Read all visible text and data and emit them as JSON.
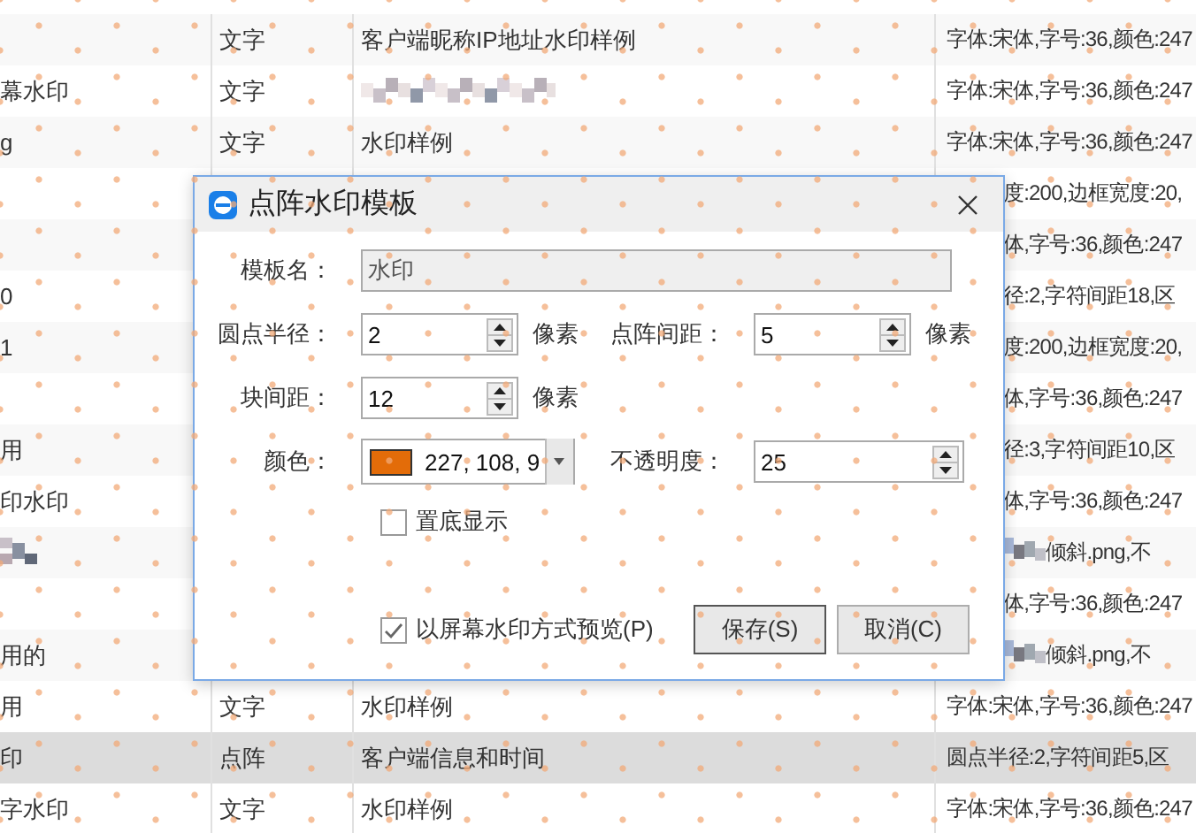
{
  "table": {
    "rows": [
      {
        "col1": "",
        "type": "文字",
        "content": "客户端昵称IP地址水印样例",
        "params": "字体:宋体,字号:36,颜色:247",
        "selected": false
      },
      {
        "col1": "幕水印",
        "type": "文字",
        "content_pixelated": true,
        "params": "字体:宋体,字号:36,颜色:247",
        "selected": false
      },
      {
        "col1": "g",
        "type": "文字",
        "content": "水印样例",
        "params": "字体:宋体,字号:36,颜色:247",
        "selected": false
      },
      {
        "col1": "",
        "covered": true,
        "params": "度:200,边框宽度:20,",
        "selected": false
      },
      {
        "col1": "",
        "covered": true,
        "params": "体,字号:36,颜色:247",
        "selected": false
      },
      {
        "col1": "0",
        "covered": true,
        "params": "径:2,字符间距18,区",
        "selected": false
      },
      {
        "col1": "1",
        "covered": true,
        "params": "度:200,边框宽度:20,",
        "selected": false
      },
      {
        "col1": "",
        "covered": true,
        "params": "体,字号:36,颜色:247",
        "selected": false
      },
      {
        "col1": "用",
        "covered": true,
        "params": "径:3,字符间距10,区",
        "selected": false
      },
      {
        "col1": "印水印",
        "covered": true,
        "params": "体,字号:36,颜色:247",
        "selected": false
      },
      {
        "col1_pixelated": true,
        "covered": true,
        "params_pixelated": true,
        "params": "倾斜.png,不",
        "selected": false
      },
      {
        "col1": "",
        "covered": true,
        "params": "体,字号:36,颜色:247",
        "selected": false
      },
      {
        "col1": "用的",
        "covered": true,
        "params_pixelated": true,
        "params": "倾斜.png,不",
        "selected": false
      },
      {
        "col1": "用",
        "type": "文字",
        "content": "水印样例",
        "params": "字体:宋体,字号:36,颜色:247",
        "selected": false
      },
      {
        "col1": "印",
        "type": "点阵",
        "content": "客户端信息和时间",
        "params": "圆点半径:2,字符间距5,区",
        "selected": true
      },
      {
        "col1": "字水印",
        "type": "文字",
        "content": "水印样例",
        "params": "字体:宋体,字号:36,颜色:247",
        "selected": false
      }
    ]
  },
  "dialog": {
    "title": "点阵水印模板",
    "template_name": {
      "label": "模板名：",
      "value": "水印",
      "disabled": true
    },
    "dot_radius": {
      "label": "圆点半径：",
      "value": "2",
      "unit": "像素"
    },
    "dot_spacing": {
      "label": "点阵间距：",
      "value": "5",
      "unit": "像素"
    },
    "block_spacing": {
      "label": "块间距：",
      "value": "12",
      "unit": "像素"
    },
    "color": {
      "label": "颜色：",
      "value": "227, 108, 9"
    },
    "opacity": {
      "label": "不透明度：",
      "value": "25"
    },
    "bottom_display": {
      "label": "置底显示",
      "checked": false
    },
    "preview": {
      "label": "以屏幕水印方式预览(P)",
      "checked": true
    },
    "buttons": [
      {
        "label": "保存(S)",
        "default": true
      },
      {
        "label": "取消(C)",
        "default": false
      }
    ]
  }
}
